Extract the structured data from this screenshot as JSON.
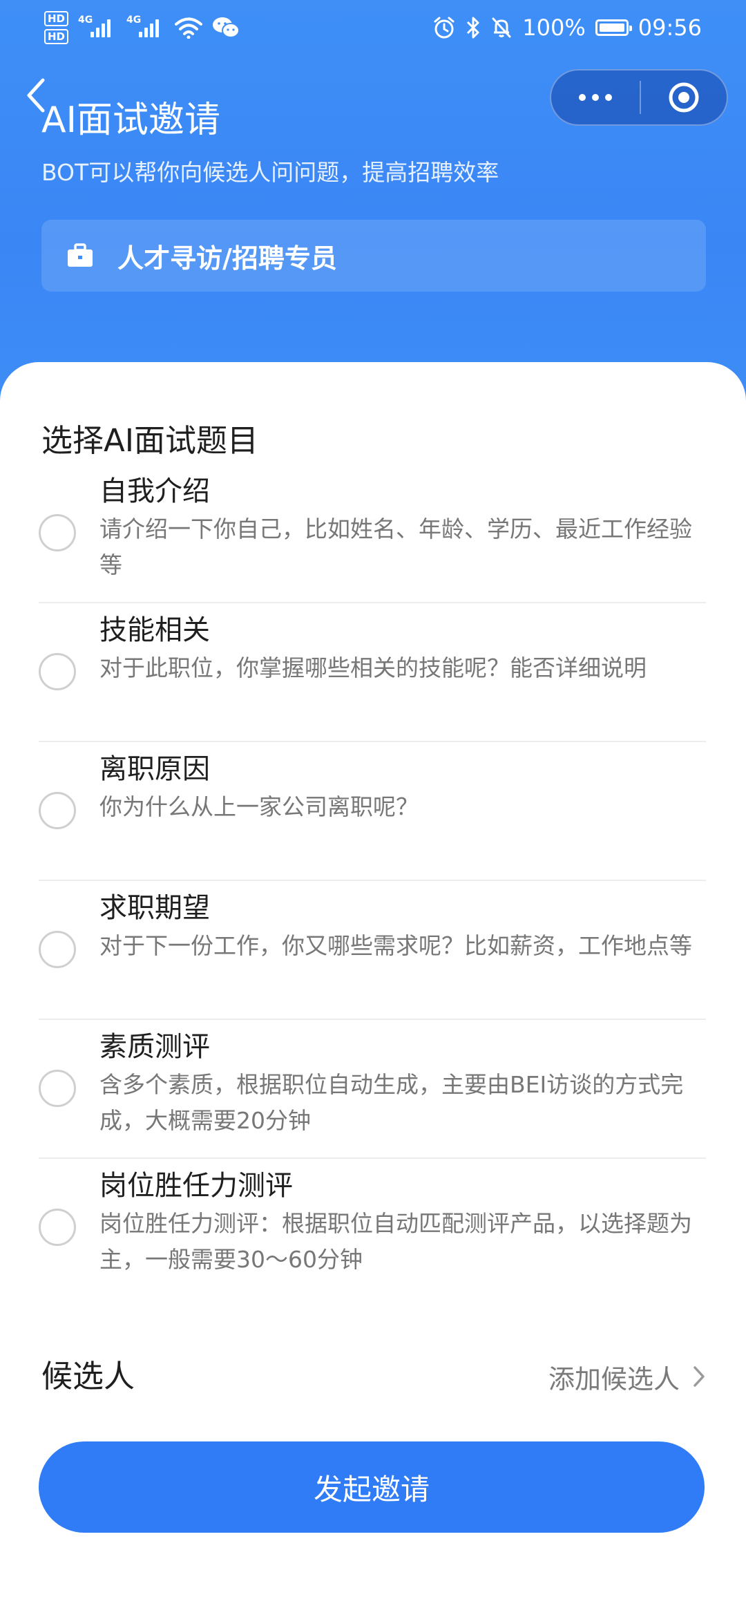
{
  "status_bar": {
    "hd1": "HD",
    "hd2": "HD",
    "sig1_tag": "4G",
    "sig2_tag": "4G",
    "battery": "100%",
    "time": "09:56"
  },
  "header": {
    "title": "AI面试邀请",
    "subtitle": "BOT可以帮你向候选人问问题，提高招聘效率",
    "job_title": "人才寻访/招聘专员"
  },
  "questions": {
    "section_title": "选择AI面试题目",
    "items": [
      {
        "title": "自我介绍",
        "desc": "请介绍一下你自己，比如姓名、年龄、学历、最近工作经验等"
      },
      {
        "title": "技能相关",
        "desc": "对于此职位，你掌握哪些相关的技能呢？能否详细说明"
      },
      {
        "title": "离职原因",
        "desc": "你为什么从上一家公司离职呢？"
      },
      {
        "title": "求职期望",
        "desc": "对于下一份工作，你又哪些需求呢？比如薪资，工作地点等"
      },
      {
        "title": "素质测评",
        "desc": "含多个素质，根据职位自动生成，主要由BEI访谈的方式完成，大概需要20分钟"
      },
      {
        "title": "岗位胜任力测评",
        "desc": "岗位胜任力测评：根据职位自动匹配测评产品，以选择题为主，一般需要30～60分钟"
      }
    ]
  },
  "candidate": {
    "label": "候选人",
    "action": "添加候选人"
  },
  "cta": {
    "label": "发起邀请"
  },
  "colors": {
    "primary": "#2f7cf6",
    "header_bg": "#3f8ff7",
    "muted_text": "#777777"
  }
}
